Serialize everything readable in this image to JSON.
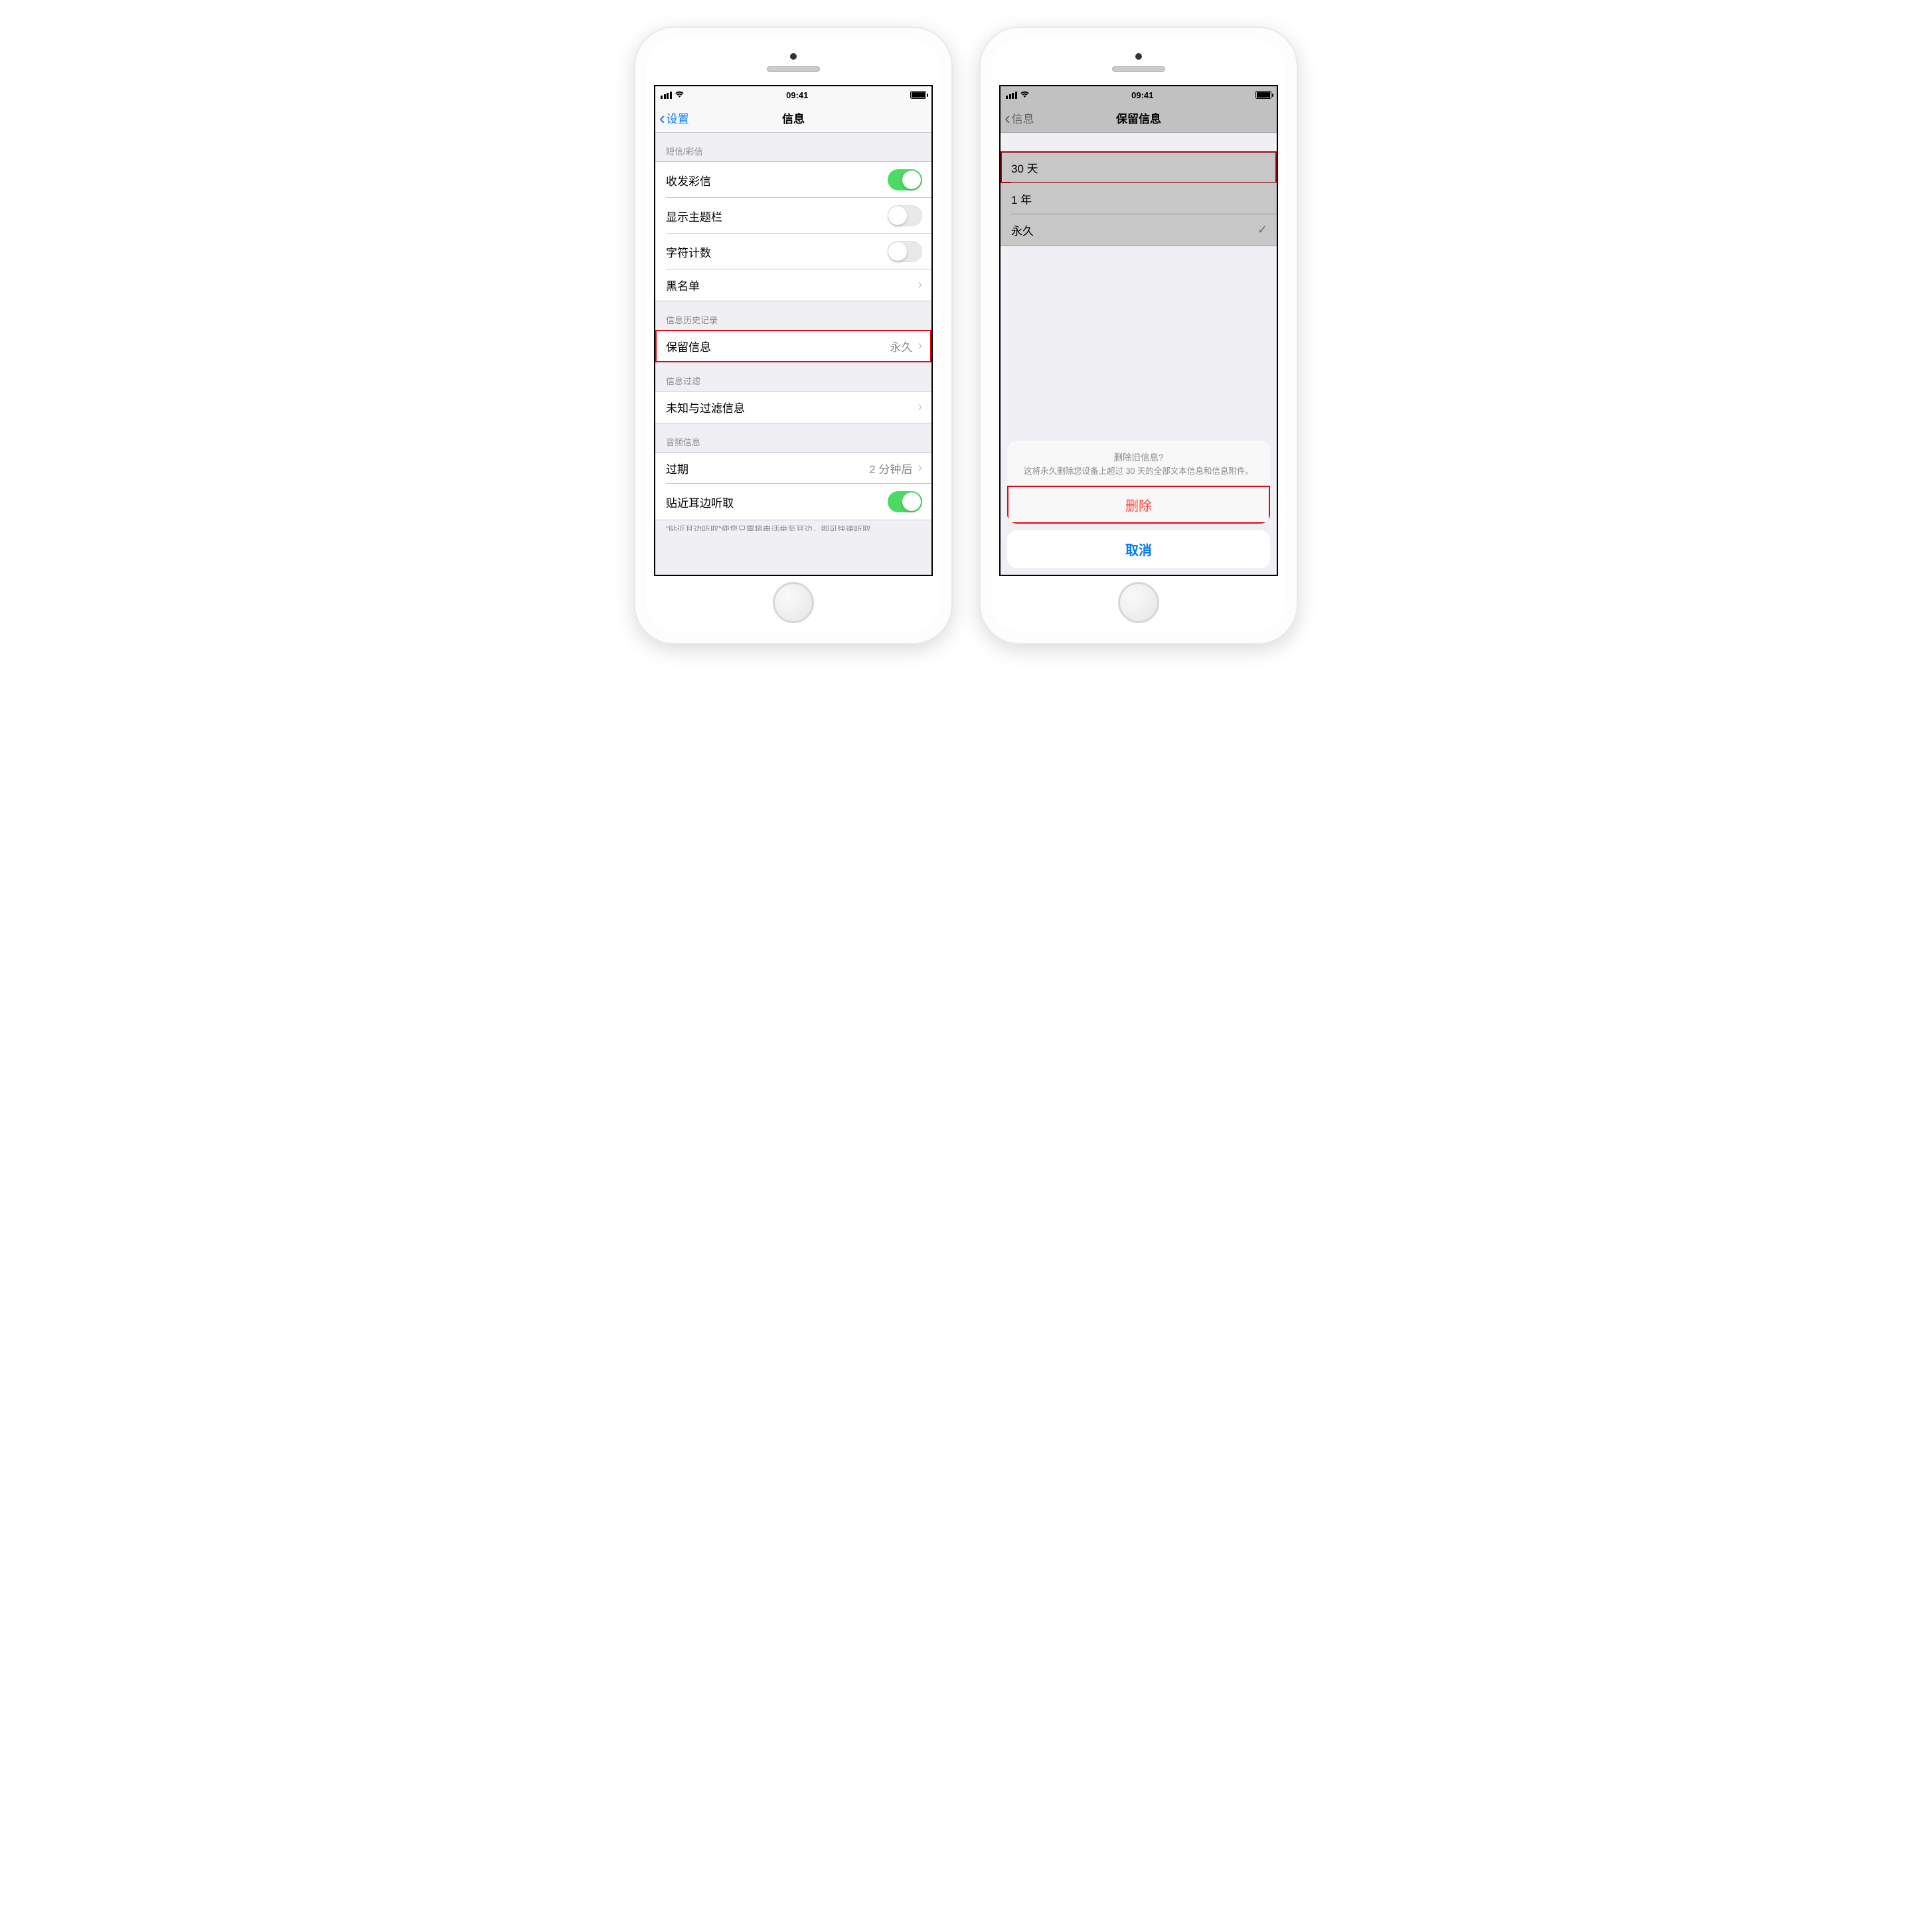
{
  "status": {
    "time": "09:41"
  },
  "left": {
    "back_label": "设置",
    "title": "信息",
    "groups": {
      "sms": {
        "header": "短信/彩信",
        "mms_label": "收发彩信",
        "subject_label": "显示主题栏",
        "charcount_label": "字符计数",
        "blacklist_label": "黑名单"
      },
      "history": {
        "header": "信息历史记录",
        "keep_label": "保留信息",
        "keep_value": "永久"
      },
      "filter": {
        "header": "信息过滤",
        "unknown_label": "未知与过滤信息"
      },
      "audio": {
        "header": "音频信息",
        "expire_label": "过期",
        "expire_value": "2 分钟后",
        "raise_label": "贴近耳边听取"
      }
    },
    "footer_note": "“贴近耳边听取”使您只需将电话举至耳边，即可快速听取"
  },
  "right": {
    "back_label": "信息",
    "title": "保留信息",
    "options": {
      "thirty": "30 天",
      "oneyear": "1 年",
      "forever": "永久"
    },
    "sheet": {
      "title": "删除旧信息?",
      "msg": "这将永久删除您设备上超过 30 天的全部文本信息和信息附件。",
      "delete": "删除",
      "cancel": "取消"
    }
  }
}
